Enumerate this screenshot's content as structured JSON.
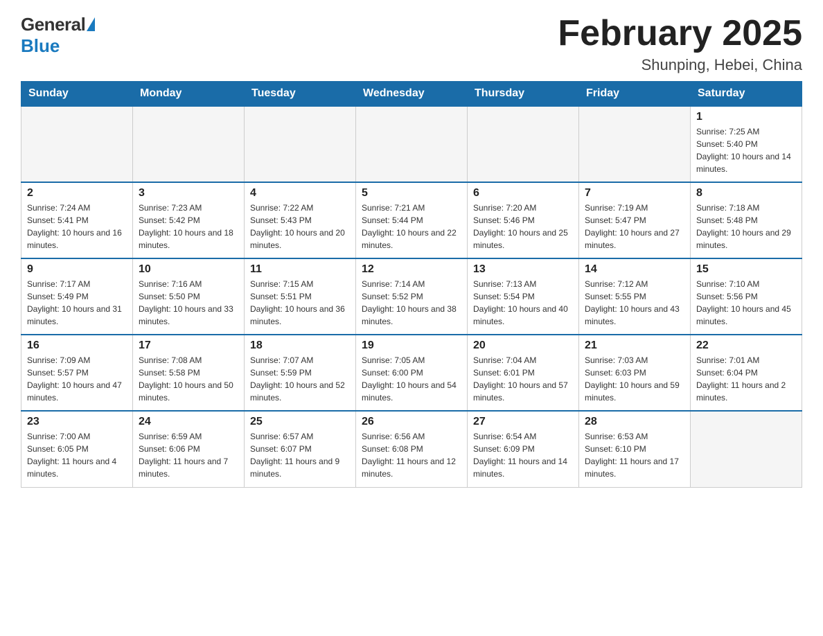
{
  "header": {
    "logo_general": "General",
    "logo_blue": "Blue",
    "month_title": "February 2025",
    "location": "Shunping, Hebei, China"
  },
  "days_of_week": [
    "Sunday",
    "Monday",
    "Tuesday",
    "Wednesday",
    "Thursday",
    "Friday",
    "Saturday"
  ],
  "weeks": [
    [
      {
        "day": "",
        "sunrise": "",
        "sunset": "",
        "daylight": ""
      },
      {
        "day": "",
        "sunrise": "",
        "sunset": "",
        "daylight": ""
      },
      {
        "day": "",
        "sunrise": "",
        "sunset": "",
        "daylight": ""
      },
      {
        "day": "",
        "sunrise": "",
        "sunset": "",
        "daylight": ""
      },
      {
        "day": "",
        "sunrise": "",
        "sunset": "",
        "daylight": ""
      },
      {
        "day": "",
        "sunrise": "",
        "sunset": "",
        "daylight": ""
      },
      {
        "day": "1",
        "sunrise": "Sunrise: 7:25 AM",
        "sunset": "Sunset: 5:40 PM",
        "daylight": "Daylight: 10 hours and 14 minutes."
      }
    ],
    [
      {
        "day": "2",
        "sunrise": "Sunrise: 7:24 AM",
        "sunset": "Sunset: 5:41 PM",
        "daylight": "Daylight: 10 hours and 16 minutes."
      },
      {
        "day": "3",
        "sunrise": "Sunrise: 7:23 AM",
        "sunset": "Sunset: 5:42 PM",
        "daylight": "Daylight: 10 hours and 18 minutes."
      },
      {
        "day": "4",
        "sunrise": "Sunrise: 7:22 AM",
        "sunset": "Sunset: 5:43 PM",
        "daylight": "Daylight: 10 hours and 20 minutes."
      },
      {
        "day": "5",
        "sunrise": "Sunrise: 7:21 AM",
        "sunset": "Sunset: 5:44 PM",
        "daylight": "Daylight: 10 hours and 22 minutes."
      },
      {
        "day": "6",
        "sunrise": "Sunrise: 7:20 AM",
        "sunset": "Sunset: 5:46 PM",
        "daylight": "Daylight: 10 hours and 25 minutes."
      },
      {
        "day": "7",
        "sunrise": "Sunrise: 7:19 AM",
        "sunset": "Sunset: 5:47 PM",
        "daylight": "Daylight: 10 hours and 27 minutes."
      },
      {
        "day": "8",
        "sunrise": "Sunrise: 7:18 AM",
        "sunset": "Sunset: 5:48 PM",
        "daylight": "Daylight: 10 hours and 29 minutes."
      }
    ],
    [
      {
        "day": "9",
        "sunrise": "Sunrise: 7:17 AM",
        "sunset": "Sunset: 5:49 PM",
        "daylight": "Daylight: 10 hours and 31 minutes."
      },
      {
        "day": "10",
        "sunrise": "Sunrise: 7:16 AM",
        "sunset": "Sunset: 5:50 PM",
        "daylight": "Daylight: 10 hours and 33 minutes."
      },
      {
        "day": "11",
        "sunrise": "Sunrise: 7:15 AM",
        "sunset": "Sunset: 5:51 PM",
        "daylight": "Daylight: 10 hours and 36 minutes."
      },
      {
        "day": "12",
        "sunrise": "Sunrise: 7:14 AM",
        "sunset": "Sunset: 5:52 PM",
        "daylight": "Daylight: 10 hours and 38 minutes."
      },
      {
        "day": "13",
        "sunrise": "Sunrise: 7:13 AM",
        "sunset": "Sunset: 5:54 PM",
        "daylight": "Daylight: 10 hours and 40 minutes."
      },
      {
        "day": "14",
        "sunrise": "Sunrise: 7:12 AM",
        "sunset": "Sunset: 5:55 PM",
        "daylight": "Daylight: 10 hours and 43 minutes."
      },
      {
        "day": "15",
        "sunrise": "Sunrise: 7:10 AM",
        "sunset": "Sunset: 5:56 PM",
        "daylight": "Daylight: 10 hours and 45 minutes."
      }
    ],
    [
      {
        "day": "16",
        "sunrise": "Sunrise: 7:09 AM",
        "sunset": "Sunset: 5:57 PM",
        "daylight": "Daylight: 10 hours and 47 minutes."
      },
      {
        "day": "17",
        "sunrise": "Sunrise: 7:08 AM",
        "sunset": "Sunset: 5:58 PM",
        "daylight": "Daylight: 10 hours and 50 minutes."
      },
      {
        "day": "18",
        "sunrise": "Sunrise: 7:07 AM",
        "sunset": "Sunset: 5:59 PM",
        "daylight": "Daylight: 10 hours and 52 minutes."
      },
      {
        "day": "19",
        "sunrise": "Sunrise: 7:05 AM",
        "sunset": "Sunset: 6:00 PM",
        "daylight": "Daylight: 10 hours and 54 minutes."
      },
      {
        "day": "20",
        "sunrise": "Sunrise: 7:04 AM",
        "sunset": "Sunset: 6:01 PM",
        "daylight": "Daylight: 10 hours and 57 minutes."
      },
      {
        "day": "21",
        "sunrise": "Sunrise: 7:03 AM",
        "sunset": "Sunset: 6:03 PM",
        "daylight": "Daylight: 10 hours and 59 minutes."
      },
      {
        "day": "22",
        "sunrise": "Sunrise: 7:01 AM",
        "sunset": "Sunset: 6:04 PM",
        "daylight": "Daylight: 11 hours and 2 minutes."
      }
    ],
    [
      {
        "day": "23",
        "sunrise": "Sunrise: 7:00 AM",
        "sunset": "Sunset: 6:05 PM",
        "daylight": "Daylight: 11 hours and 4 minutes."
      },
      {
        "day": "24",
        "sunrise": "Sunrise: 6:59 AM",
        "sunset": "Sunset: 6:06 PM",
        "daylight": "Daylight: 11 hours and 7 minutes."
      },
      {
        "day": "25",
        "sunrise": "Sunrise: 6:57 AM",
        "sunset": "Sunset: 6:07 PM",
        "daylight": "Daylight: 11 hours and 9 minutes."
      },
      {
        "day": "26",
        "sunrise": "Sunrise: 6:56 AM",
        "sunset": "Sunset: 6:08 PM",
        "daylight": "Daylight: 11 hours and 12 minutes."
      },
      {
        "day": "27",
        "sunrise": "Sunrise: 6:54 AM",
        "sunset": "Sunset: 6:09 PM",
        "daylight": "Daylight: 11 hours and 14 minutes."
      },
      {
        "day": "28",
        "sunrise": "Sunrise: 6:53 AM",
        "sunset": "Sunset: 6:10 PM",
        "daylight": "Daylight: 11 hours and 17 minutes."
      },
      {
        "day": "",
        "sunrise": "",
        "sunset": "",
        "daylight": ""
      }
    ]
  ]
}
